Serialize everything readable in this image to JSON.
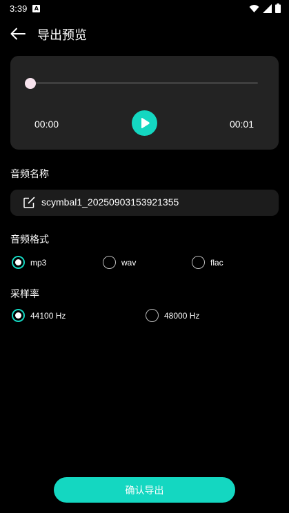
{
  "status_bar": {
    "time": "3:39",
    "notification_glyph": "A"
  },
  "header": {
    "title": "导出预览"
  },
  "player": {
    "current_time": "00:00",
    "total_time": "00:01",
    "progress": 0
  },
  "audio_name": {
    "label": "音频名称",
    "value": "scymbal1_20250903153921355"
  },
  "audio_format": {
    "label": "音频格式",
    "options": [
      {
        "label": "mp3",
        "selected": true
      },
      {
        "label": "wav",
        "selected": false
      },
      {
        "label": "flac",
        "selected": false
      }
    ]
  },
  "sample_rate": {
    "label": "采样率",
    "options": [
      {
        "label": "44100 Hz",
        "selected": true
      },
      {
        "label": "48000 Hz",
        "selected": false
      }
    ]
  },
  "confirm_button": {
    "label": "确认导出"
  },
  "colors": {
    "accent": "#14d7c1",
    "card": "#232323",
    "field": "#1c1c1c",
    "background": "#000000"
  }
}
